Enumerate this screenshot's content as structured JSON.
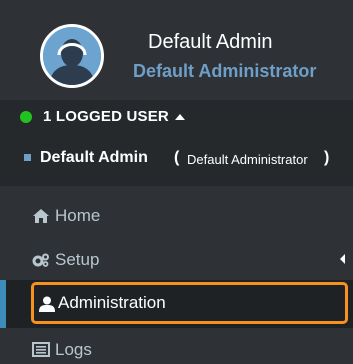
{
  "profile": {
    "name": "Default Admin",
    "role": "Default Administrator",
    "avatar_icon": "user-avatar-icon"
  },
  "logged_users": {
    "label": "1 LOGGED USER",
    "status_color": "#22c321",
    "users": [
      {
        "name": "Default Admin",
        "role": "Default Administrator"
      }
    ]
  },
  "nav": {
    "items": [
      {
        "label": "Home",
        "icon": "home-icon"
      },
      {
        "label": "Setup",
        "icon": "cogs-icon"
      },
      {
        "label": "Administration",
        "icon": "user-icon",
        "active": true
      },
      {
        "label": "Logs",
        "icon": "list-icon"
      }
    ]
  },
  "colors": {
    "accent": "#3c8dbc",
    "highlight": "#f7921e",
    "role_text": "#6f9ec6"
  }
}
